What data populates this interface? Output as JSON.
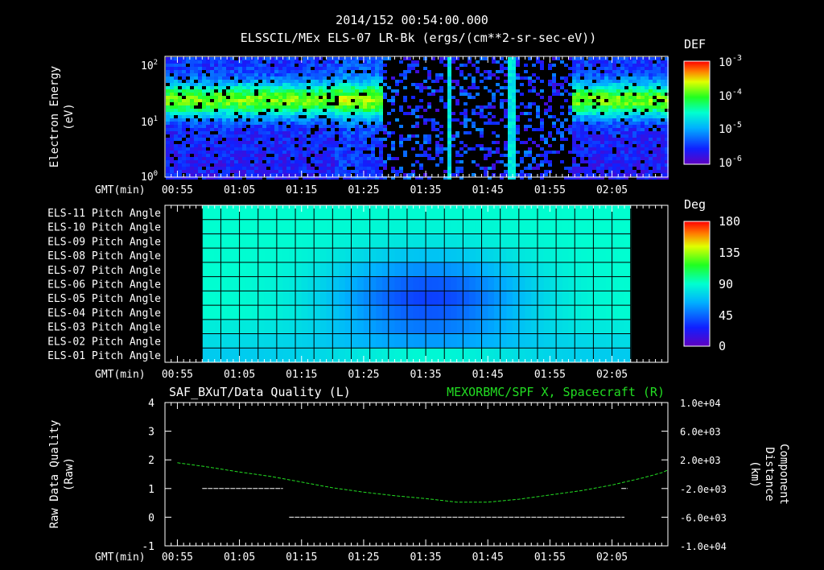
{
  "header": {
    "timestamp": "2014/152 00:54:00.000",
    "title": "ELSSCIL/MEx ELS-07 LR-Bk  (ergs/(cm**2-sr-sec-eV))"
  },
  "time_axis": {
    "prefix": "GMT(min)",
    "labels": [
      "00:55",
      "01:05",
      "01:15",
      "01:25",
      "01:35",
      "01:45",
      "01:55",
      "02:05"
    ]
  },
  "chart_data": [
    {
      "type": "heatmap",
      "name": "spectrogram",
      "ylabel_line1": "Electron Energy",
      "ylabel_line2": "(eV)",
      "yscale": "log",
      "ylim": [
        1,
        150
      ],
      "y_ticks": [
        {
          "base": "10",
          "exp": "2"
        },
        {
          "base": "10",
          "exp": "1"
        },
        {
          "base": "10",
          "exp": "0"
        }
      ],
      "colorbar": {
        "title": "DEF",
        "ticks": [
          {
            "base": "10",
            "exp": "-3"
          },
          {
            "base": "10",
            "exp": "-4"
          },
          {
            "base": "10",
            "exp": "-5"
          },
          {
            "base": "10",
            "exp": "-6"
          }
        ]
      },
      "colors": {
        "low": "#2a0a8c",
        "mid_low": "#2040ff",
        "mid": "#00e0e0",
        "mid_high": "#30ff30",
        "high": "#c0ff00"
      }
    },
    {
      "type": "heatmap",
      "name": "pitch-angle",
      "rows": [
        "ELS-11 Pitch Angle",
        "ELS-10 Pitch Angle",
        "ELS-09 Pitch Angle",
        "ELS-08 Pitch Angle",
        "ELS-07 Pitch Angle",
        "ELS-06 Pitch Angle",
        "ELS-05 Pitch Angle",
        "ELS-04 Pitch Angle",
        "ELS-03 Pitch Angle",
        "ELS-02 Pitch Angle",
        "ELS-01 Pitch Angle"
      ],
      "colorbar": {
        "title": "Deg",
        "ticks": [
          "180",
          "135",
          "90",
          "45",
          "0"
        ]
      },
      "data_range_minutes": [
        59,
        128
      ]
    },
    {
      "type": "line",
      "name": "quality-and-position",
      "title_left": "SAF_BXuT/Data Quality (L)",
      "title_right": "MEXORBMC/SPF X, Spacecraft (R)",
      "ylabel_left_line1": "Raw Data Quality",
      "ylabel_left_line2": "(Raw)",
      "ylabel_right_line1": "Component",
      "ylabel_right_line2": "Distance",
      "ylabel_right_line3": "(km)",
      "left_ticks": [
        "4",
        "3",
        "2",
        "1",
        "0",
        "-1"
      ],
      "right_ticks": [
        "1.0e+04",
        "6.0e+03",
        "2.0e+03",
        "-2.0e+03",
        "-6.0e+03",
        "-1.0e+04"
      ],
      "left_ylim": [
        -1,
        4
      ],
      "right_ylim": [
        -10000,
        10000
      ],
      "quality_segments": [
        {
          "t_start": 59,
          "t_end": 72,
          "value": 1
        },
        {
          "t_start": 73,
          "t_end": 127,
          "value": 0
        },
        {
          "t_start": 126.5,
          "t_end": 127.5,
          "value": 1
        }
      ],
      "spf_x": {
        "color": "#22dd22",
        "points": [
          [
            55,
            1600
          ],
          [
            60,
            1000
          ],
          [
            65,
            300
          ],
          [
            70,
            -300
          ],
          [
            75,
            -1100
          ],
          [
            80,
            -1900
          ],
          [
            85,
            -2500
          ],
          [
            90,
            -3000
          ],
          [
            95,
            -3400
          ],
          [
            100,
            -3900
          ],
          [
            105,
            -3900
          ],
          [
            110,
            -3500
          ],
          [
            115,
            -2900
          ],
          [
            120,
            -2300
          ],
          [
            125,
            -1500
          ],
          [
            130,
            -500
          ],
          [
            133,
            200
          ],
          [
            134,
            600
          ]
        ]
      }
    }
  ]
}
